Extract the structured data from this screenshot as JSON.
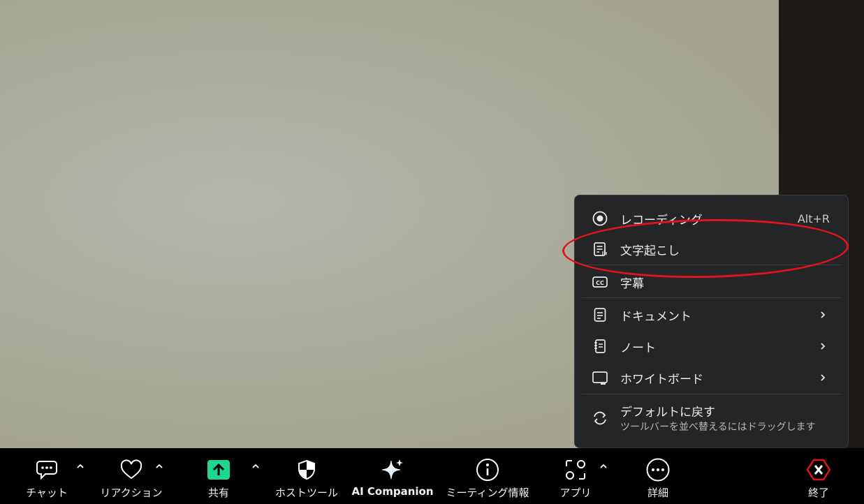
{
  "colors": {
    "menu_bg": "#242526",
    "share_green": "#1ed68f",
    "end_red": "#e0141e",
    "highlight": "#e0141e"
  },
  "menu": {
    "items": [
      {
        "label": "レコーディング",
        "shortcut": "Alt+R",
        "icon": "record-icon"
      },
      {
        "label": "文字起こし",
        "icon": "transcript-icon"
      },
      {
        "label": "字幕",
        "icon": "closed-caption-icon"
      },
      {
        "label": "ドキュメント",
        "icon": "document-icon",
        "submenu": true
      },
      {
        "label": "ノート",
        "icon": "notes-icon",
        "submenu": true
      },
      {
        "label": "ホワイトボード",
        "icon": "whiteboard-icon",
        "submenu": true
      },
      {
        "label": "デフォルトに戻す",
        "sublabel": "ツールバーを並べ替えるにはドラッグします",
        "icon": "reset-icon"
      }
    ]
  },
  "toolbar": {
    "chat": "チャット",
    "reactions": "リアクション",
    "share": "共有",
    "host_tools": "ホストツール",
    "ai_companion": "AI Companion",
    "meeting_info": "ミーティング情報",
    "apps": "アプリ",
    "more": "詳細",
    "end": "終了"
  }
}
